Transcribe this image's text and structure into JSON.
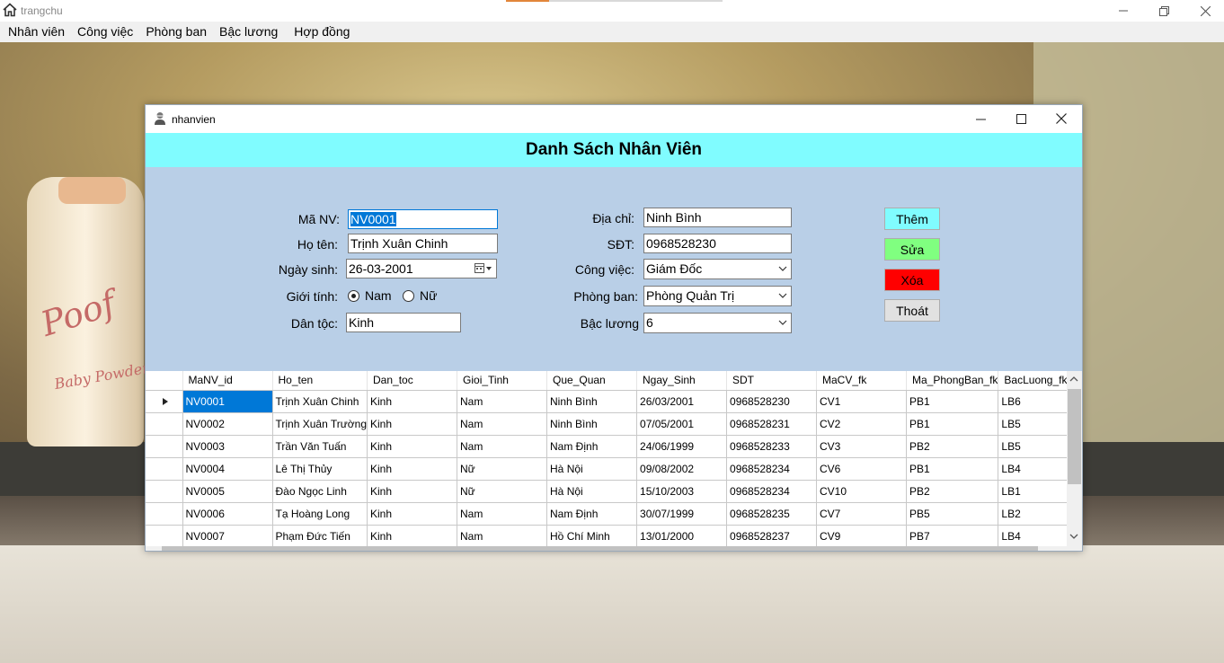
{
  "main_window": {
    "title": "trangchu",
    "controls": {
      "minimize": "minimize-icon",
      "restore": "restore-icon",
      "close": "close-icon"
    }
  },
  "menu": {
    "items": [
      {
        "label": "Nhân viên"
      },
      {
        "label": "Công việc"
      },
      {
        "label": "Phòng ban"
      },
      {
        "label": "Bậc lương"
      },
      {
        "label": "Hợp đồng"
      }
    ]
  },
  "background": {
    "poof_text": "Poof",
    "powder_text": "Baby Powder"
  },
  "child_window": {
    "title": "nhanvien",
    "header_title": "Danh Sách Nhân Viên",
    "header_color": "#80fcff",
    "form_color": "#b9cfe7"
  },
  "form": {
    "ma_nv": {
      "label": "Mã NV:",
      "value": "NV0001"
    },
    "ho_ten": {
      "label": "Họ tên:",
      "value": "Trịnh Xuân Chinh"
    },
    "ngay_sinh": {
      "label": "Ngày sinh:",
      "value": "26-03-2001"
    },
    "gioi_tinh": {
      "label": "Giới tính:",
      "option_male": "Nam",
      "option_female": "Nữ",
      "selected": "Nam"
    },
    "dan_toc": {
      "label": "Dân tộc:",
      "value": "Kinh"
    },
    "dia_chi": {
      "label": "Địa chỉ:",
      "value": "Ninh Bình"
    },
    "sdt": {
      "label": "SĐT:",
      "value": "0968528230"
    },
    "cong_viec": {
      "label": "Công việc:",
      "value": "Giám Đốc"
    },
    "phong_ban": {
      "label": "Phòng ban:",
      "value": "Phòng Quản Trị"
    },
    "bac_luong": {
      "label": "Bậc lương",
      "value": "6"
    }
  },
  "buttons": {
    "them": {
      "label": "Thêm",
      "color": "#80fcff"
    },
    "sua": {
      "label": "Sửa",
      "color": "#80ff80"
    },
    "xoa": {
      "label": "Xóa",
      "color": "#ff0000"
    },
    "thoat": {
      "label": "Thoát",
      "color": "#e1e1e1"
    }
  },
  "grid": {
    "columns": [
      "MaNV_id",
      "Ho_ten",
      "Dan_toc",
      "Gioi_Tinh",
      "Que_Quan",
      "Ngay_Sinh",
      "SDT",
      "MaCV_fk",
      "Ma_PhongBan_fk",
      "BacLuong_fk"
    ],
    "rows": [
      [
        "NV0001",
        "Trịnh Xuân Chinh",
        "Kinh",
        "Nam",
        "Ninh Bình",
        "26/03/2001",
        "0968528230",
        "CV1",
        "PB1",
        "LB6"
      ],
      [
        "NV0002",
        "Trịnh Xuân Trường",
        "Kinh",
        "Nam",
        "Ninh Bình",
        "07/05/2001",
        "0968528231",
        "CV2",
        "PB1",
        "LB5"
      ],
      [
        "NV0003",
        "Trần Văn Tuấn",
        "Kinh",
        "Nam",
        "Nam Định",
        "24/06/1999",
        "0968528233",
        "CV3",
        "PB2",
        "LB5"
      ],
      [
        "NV0004",
        "Lê Thị Thủy",
        "Kinh",
        "Nữ",
        "Hà Nội",
        "09/08/2002",
        "0968528234",
        "CV6",
        "PB1",
        "LB4"
      ],
      [
        "NV0005",
        "Đào Ngọc Linh",
        "Kinh",
        "Nữ",
        "Hà Nội",
        "15/10/2003",
        "0968528234",
        "CV10",
        "PB2",
        "LB1"
      ],
      [
        "NV0006",
        "Tạ Hoàng Long",
        "Kinh",
        "Nam",
        "Nam Định",
        "30/07/1999",
        "0968528235",
        "CV7",
        "PB5",
        "LB2"
      ],
      [
        "NV0007",
        "Phạm Đức Tiến",
        "Kinh",
        "Nam",
        "Hồ Chí Minh",
        "13/01/2000",
        "0968528237",
        "CV9",
        "PB7",
        "LB4"
      ]
    ],
    "selection_color": "#0078d7"
  }
}
